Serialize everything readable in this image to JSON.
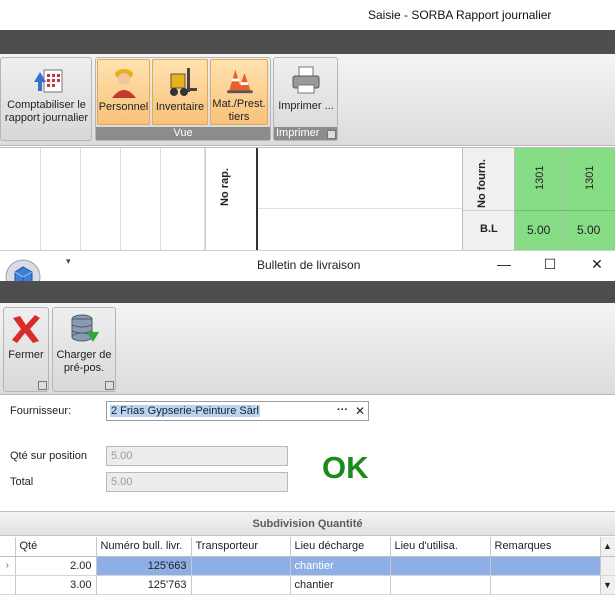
{
  "main_window": {
    "title": "Saisie - SORBA Rapport journalier"
  },
  "ribbon": {
    "buttons": [
      {
        "label": "Comptabiliser le rapport journalier",
        "icon": "post-report-icon"
      },
      {
        "label": "Personnel",
        "icon": "worker-icon"
      },
      {
        "label": "Inventaire",
        "icon": "forklift-icon"
      },
      {
        "label": "Mat./Prest. tiers",
        "icon": "cones-icon"
      },
      {
        "label": "Imprimer ...",
        "icon": "printer-icon"
      }
    ],
    "groups": {
      "vue": "Vue",
      "imprimer": "Imprimer"
    }
  },
  "grid": {
    "no_rap_header": "No rap.",
    "no_fourn_header": "No fourn.",
    "bl_header": "B.L",
    "columns": [
      {
        "no_fourn": "1301",
        "bl": "5.00"
      },
      {
        "no_fourn": "1301",
        "bl": "5.00"
      }
    ],
    "highlight_color": "#86dd86"
  },
  "dialog": {
    "title": "Bulletin de livraison",
    "window_buttons": {
      "minimize": "—",
      "maximize": "☐",
      "close": "✕"
    },
    "toolbar": {
      "close_label": "Fermer",
      "load_label": "Charger de pré-pos."
    },
    "form": {
      "supplier_label": "Fournisseur:",
      "supplier_value": "2 Frias Gypserie-Peinture Sàrl",
      "supplier_ellipsis": "···",
      "supplier_clear": "✕",
      "qty_label": "Qté sur position",
      "qty_value": "5.00",
      "total_label": "Total",
      "total_value": "5.00"
    },
    "status_text": "OK",
    "subdivision": {
      "title": "Subdivision Quantité",
      "columns": [
        "Qté",
        "Numéro bull. livr.",
        "Transporteur",
        "Lieu décharge",
        "Lieu d'utilisa.",
        "Remarques"
      ],
      "rows": [
        {
          "qte": "2.00",
          "numero": "125'663",
          "transporteur": "",
          "lieu_decharge": "chantier",
          "lieu_utilisation": "",
          "remarques": ""
        },
        {
          "qte": "3.00",
          "numero": "125'763",
          "transporteur": "",
          "lieu_decharge": "chantier",
          "lieu_utilisation": "",
          "remarques": ""
        }
      ]
    }
  }
}
